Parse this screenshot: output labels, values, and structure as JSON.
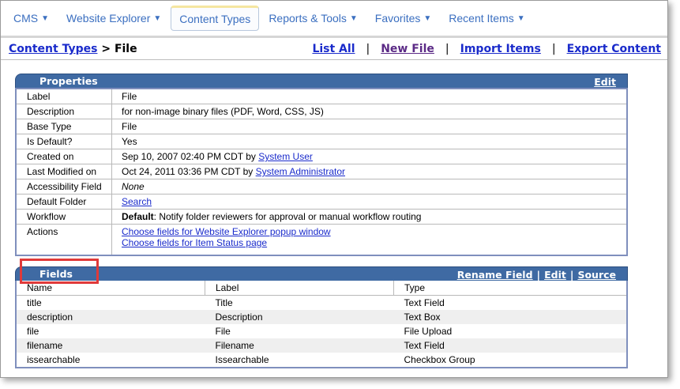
{
  "menu": {
    "items": [
      {
        "label": "CMS"
      },
      {
        "label": "Website Explorer"
      },
      {
        "label": "Content Types"
      },
      {
        "label": "Reports & Tools"
      },
      {
        "label": "Favorites"
      },
      {
        "label": "Recent Items"
      }
    ],
    "arrow": "▼"
  },
  "breadcrumb": {
    "parent": "Content Types",
    "separator": ">",
    "current": "File"
  },
  "actions": {
    "list_all": "List All",
    "new_file": "New File",
    "import_items": "Import Items",
    "export_content": "Export Content",
    "sep": "|"
  },
  "properties": {
    "title": "Properties",
    "edit": "Edit",
    "rows": {
      "label": {
        "name": "Label",
        "value": "File"
      },
      "description": {
        "name": "Description",
        "value": "for non-image binary files (PDF, Word, CSS, JS)"
      },
      "base_type": {
        "name": "Base Type",
        "value": "File"
      },
      "is_default": {
        "name": "Is Default?",
        "value": "Yes"
      },
      "created_on": {
        "name": "Created on",
        "value": "Sep 10, 2007 02:40 PM CDT by ",
        "user": "System User"
      },
      "last_modified": {
        "name": "Last Modified on",
        "value": "Oct 24, 2011 03:36 PM CDT by ",
        "user": "System Administrator"
      },
      "accessibility": {
        "name": "Accessibility Field",
        "value": "None"
      },
      "default_folder": {
        "name": "Default Folder",
        "value": "Search"
      },
      "workflow": {
        "name": "Workflow",
        "bold": "Default",
        "value": ": Notify folder reviewers for approval or manual workflow routing"
      },
      "actions": {
        "name": "Actions",
        "link1": "Choose fields for Website Explorer popup window",
        "link2": "Choose fields for Item Status page"
      }
    }
  },
  "fields": {
    "title": "Fields",
    "rename": "Rename Field",
    "edit": "Edit",
    "source": "Source",
    "pipe": "|",
    "headers": {
      "name": "Name",
      "label": "Label",
      "type": "Type"
    },
    "rows": [
      {
        "name": "title",
        "label": "Title",
        "type": "Text Field"
      },
      {
        "name": "description",
        "label": "Description",
        "type": "Text Box"
      },
      {
        "name": "file",
        "label": "File",
        "type": "File Upload"
      },
      {
        "name": "filename",
        "label": "Filename",
        "type": "Text Field"
      },
      {
        "name": "issearchable",
        "label": "Issearchable",
        "type": "Checkbox Group"
      }
    ]
  },
  "colors": {
    "menu_text": "#3b6fc0",
    "link": "#1a2bcb",
    "panel_header": "#3f6aa3",
    "highlight": "#e03a3a"
  }
}
